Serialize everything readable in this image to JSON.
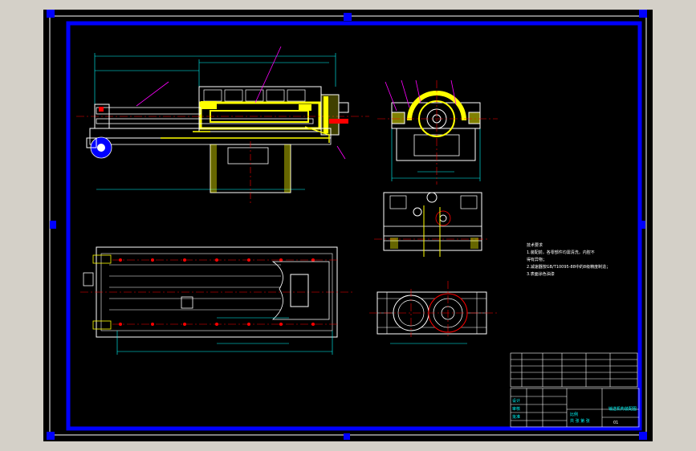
{
  "colors": {
    "background": "#000000",
    "frame": "#0000ff",
    "outline": "#ffffff",
    "highlight": "#ffff00",
    "dimension": "#00ffff",
    "centerline": "#ff0000",
    "leader": "#ff00ff",
    "hidden": "#00ff00",
    "canvas_gray": "#d4d0c8"
  },
  "tech_notes": {
    "title": "技术要求",
    "items": [
      "1.装配前，各零部件均需清洗，内腔不",
      "得有异物；",
      "2.减速器按GB/T10095-88中的8级精度制造；",
      "3.表面涂色油漆"
    ]
  },
  "title_block": {
    "drawing_name": "输送机构装配图",
    "scale_label": "比例",
    "sheet_label": "共 张 第 张",
    "designer_label": "设计",
    "checker_label": "审核",
    "approver_label": "批准",
    "number": "01"
  }
}
